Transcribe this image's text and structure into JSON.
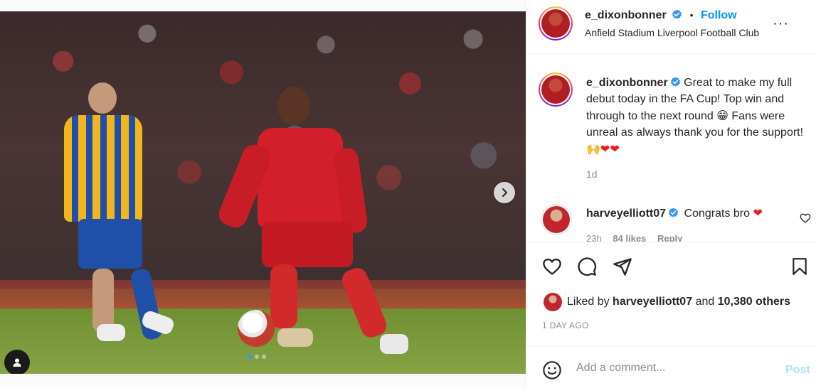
{
  "post": {
    "username": "e_dixonbonner",
    "follow_label": "Follow",
    "separator": "•",
    "location": "Anfield Stadium Liverpool Football Club",
    "more_label": "···",
    "caption": {
      "username": "e_dixonbonner",
      "text_part1": "Great to make my full debut today in the FA Cup! Top win and through to the next round",
      "emoji_grin": "😁",
      "text_part2": "Fans were unreal as always thank you for the support!",
      "emoji_pray": "🙌",
      "emoji_heart1": "❤",
      "emoji_heart2": "❤"
    },
    "age": "1d",
    "comment": {
      "username": "harveyelliott07",
      "text": "Congrats bro",
      "emoji_heart": "❤",
      "time": "23h",
      "likes": "84 likes",
      "reply": "Reply"
    },
    "liked_by": {
      "prefix": "Liked by",
      "user": "harveyelliott07",
      "conjunction": "and",
      "others": "10,380 others"
    },
    "date": "1 DAY AGO",
    "add_comment": {
      "placeholder": "Add a comment...",
      "post_label": "Post"
    }
  },
  "carousel": {
    "slide_count": 3,
    "active_index": 0
  },
  "colors": {
    "accent": "#0095f6",
    "verified": "#3897f0",
    "muted": "#8e8e8e",
    "post_disabled": "#b2dffc"
  },
  "icons": {
    "verified": "verified-badge-icon",
    "like": "heart-icon",
    "comment": "comment-bubble-icon",
    "share": "paper-plane-icon",
    "save": "bookmark-icon",
    "emoji": "smiley-icon",
    "next": "chevron-right-icon",
    "tag": "user-tag-icon"
  }
}
